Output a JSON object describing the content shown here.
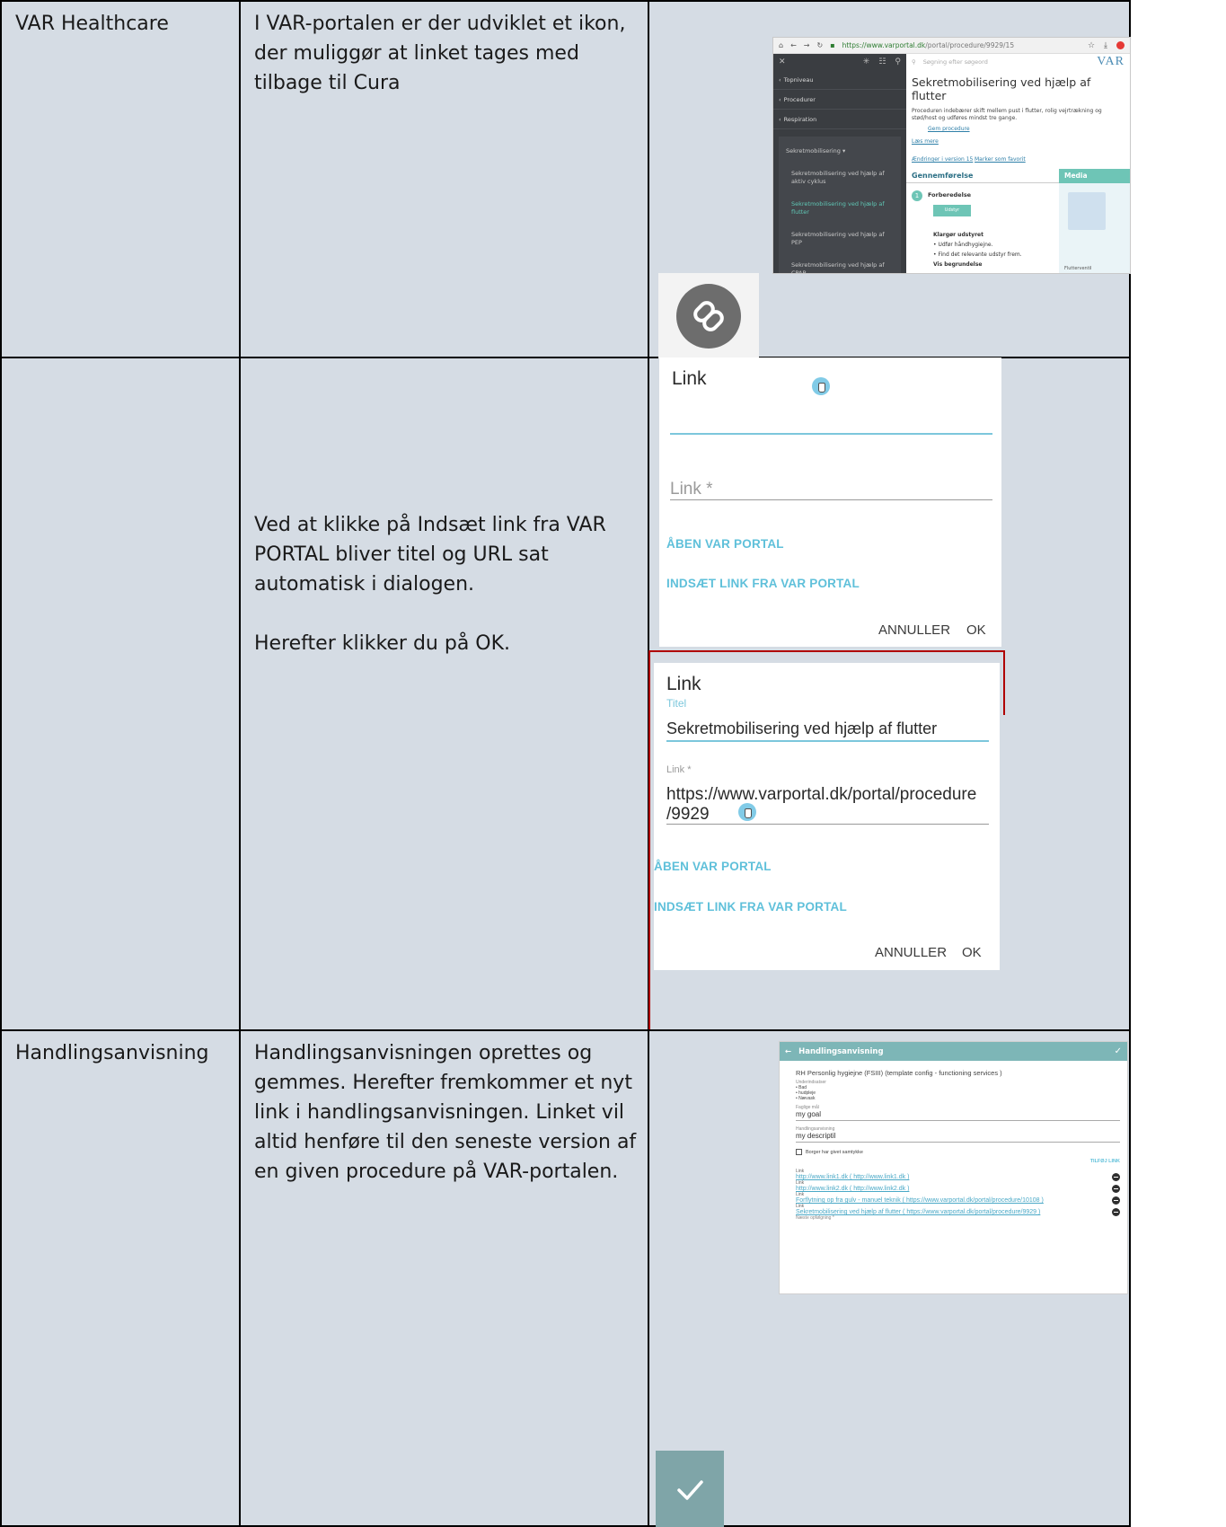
{
  "rows": [
    {
      "col1": "VAR Healthcare",
      "col2": "I VAR-portalen er der udviklet et ikon, der muliggør at linket tages med tilbage til Cura"
    },
    {
      "col1": "",
      "col2_p1": "Ved at klikke på Indsæt link fra VAR PORTAL bliver titel og URL sat automatisk i dialogen.",
      "col2_p2": "Herefter klikker du på OK."
    },
    {
      "col1": "Handlingsanvisning",
      "col2": "Handlingsanvisningen oprettes og gemmes. Herefter fremkommer et nyt link i handlingsanvisningen. Linket vil altid henføre til den seneste version af en given procedure på VAR-portalen."
    }
  ],
  "portal_screenshot": {
    "url_secure": "https://www.varportal.dk",
    "url_path": "/portal/procedure/9929/15",
    "search_placeholder": "Søgning efter søgeord",
    "logo": "VAR",
    "sidebar": [
      "Topniveau",
      "Procedurer",
      "Respiration"
    ],
    "sidebar_group": "Sekretmobilisering ▾",
    "sidebar_subs": [
      "Sekretmobilisering ved hjælp af aktiv cyklus",
      "Sekretmobilisering ved hjælp af flutter",
      "Sekretmobilisering ved hjælp af PEP",
      "Sekretmobilisering ved hjælp af CPAP"
    ],
    "title": "Sekretmobilisering ved hjælp af flutter",
    "description": "Proceduren indebærer skift mellem pust i flutter, rolig vejrtrækning og stød/host og udføres mindst tre gange.",
    "link_procedure": "Gem procedure",
    "link_more": "Læs mere",
    "link_changes": "Ændringer i version 15",
    "link_favorite": "Marker som favorit",
    "section": "Gennemførelse",
    "media": "Media",
    "step_number": "1",
    "step_title": "Forberedelse",
    "step_button": "Udstyr",
    "prep_title": "Klargør udstyret",
    "prep_items": [
      "Udfør håndhygiejne.",
      "Find det relevante udstyr frem."
    ],
    "toggle_label": "Vis begrundelse",
    "media_caption": "Flutterventil"
  },
  "dialog_empty": {
    "title": "Link",
    "link_placeholder": "Link *",
    "open_portal": "ÅBEN VAR PORTAL",
    "insert_link": "INDSÆT LINK FRA VAR PORTAL",
    "cancel": "ANNULLER",
    "ok": "OK"
  },
  "dialog_filled": {
    "title": "Link",
    "titel_label": "Titel",
    "titel_value": "Sekretmobilisering ved hjælp af flutter",
    "link_label": "Link *",
    "link_value": "https://www.varportal.dk/portal/procedure /9929",
    "open_portal": "ÅBEN VAR PORTAL",
    "insert_link": "INDSÆT LINK FRA VAR PORTAL",
    "cancel": "ANNULLER",
    "ok": "OK"
  },
  "handling_screenshot": {
    "header": "Handlingsanvisning",
    "template": "RH Personlig hygiejne (FSIII) (template config - functioning services )",
    "underindsatser_label": "Underindsatser",
    "underindsatser": [
      "Bad",
      "hudpleje",
      "Nævask"
    ],
    "goal_label": "Faglige mål",
    "goal_value": "my goal",
    "desc_label": "Handlingsanvisning",
    "desc_value": "my descriptil",
    "consent": "Borger har givet samtykke",
    "add_link": "TILFØJ LINK",
    "link_label": "Link",
    "links": [
      "http://www.link1.dk ( http://www.link1.dk )",
      "http://www.link2.dk ( http://www.link2.dk )",
      "Forflytning op fra gulv - manuel teknik ( https://www.varportal.dk/portal/procedure/10108 )",
      "Sekretmobilisering ved hjælp af flutter ( https://www.varportal.dk/portal/procedure/9929 )"
    ],
    "footer_label": "Næste opfølgning *"
  }
}
